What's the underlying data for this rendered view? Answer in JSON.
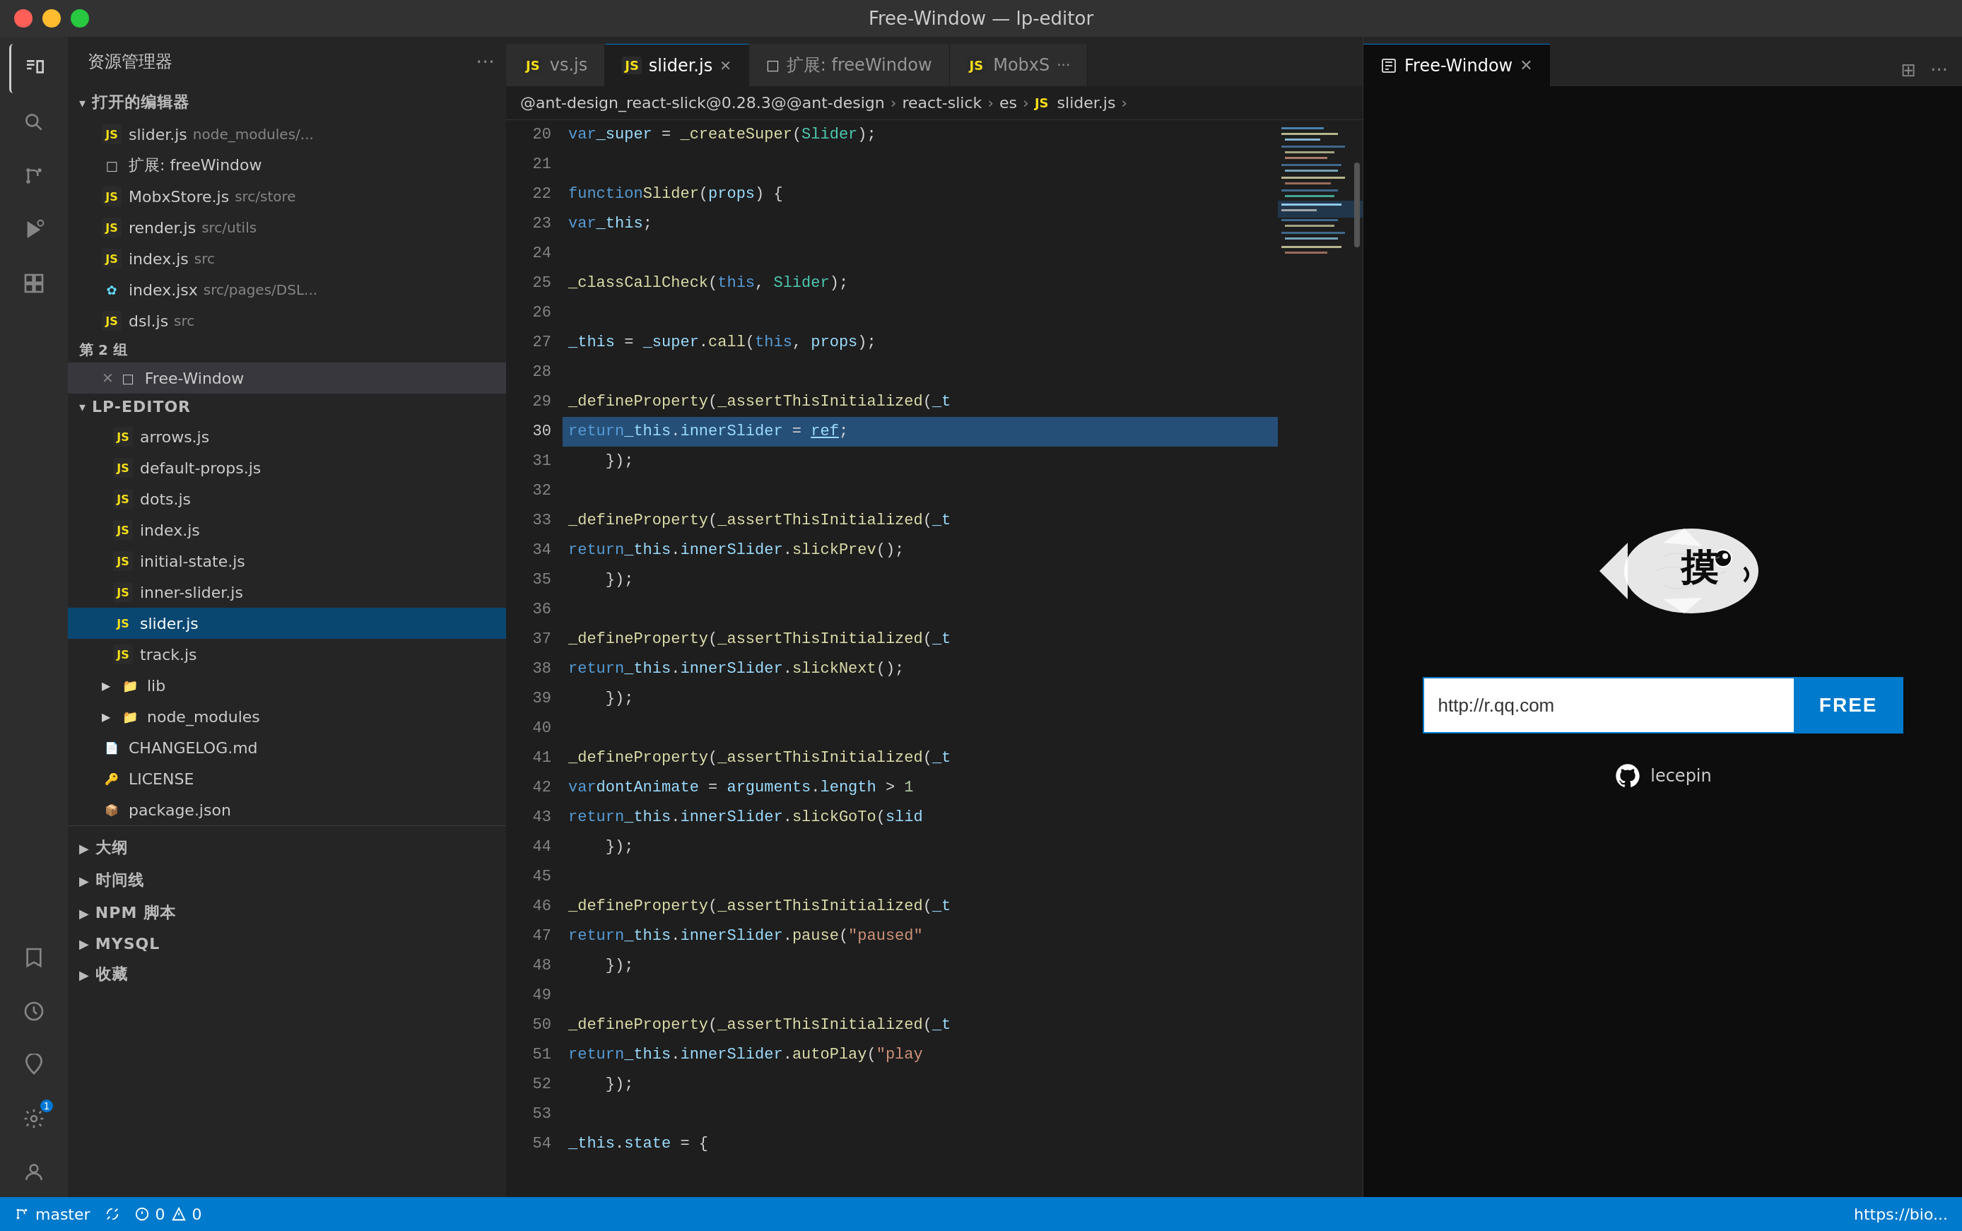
{
  "titlebar": {
    "title": "Free-Window — lp-editor"
  },
  "activitybar": {
    "icons": [
      {
        "name": "explorer-icon",
        "symbol": "⊞",
        "active": true
      },
      {
        "name": "search-icon",
        "symbol": "🔍"
      },
      {
        "name": "source-control-icon",
        "symbol": "⎇"
      },
      {
        "name": "run-icon",
        "symbol": "▷"
      },
      {
        "name": "extensions-icon",
        "symbol": "⊡"
      },
      {
        "name": "bookmarks-icon",
        "symbol": "🔖"
      },
      {
        "name": "timeline-icon",
        "symbol": "◷"
      },
      {
        "name": "favorites-icon",
        "symbol": "♡"
      },
      {
        "name": "security-icon",
        "symbol": "🛡"
      }
    ]
  },
  "sidebar": {
    "tab": "资源管理器",
    "open_editors": {
      "label": "打开的编辑器",
      "files": [
        {
          "name": "slider.js",
          "path": "node_modules/...",
          "type": "js"
        },
        {
          "name": "扩展: freeWindow",
          "type": "ext"
        },
        {
          "name": "MobxStore.js",
          "path": "src/store",
          "type": "js"
        },
        {
          "name": "render.js",
          "path": "src/utils",
          "type": "js"
        },
        {
          "name": "index.js",
          "path": "src",
          "type": "js"
        },
        {
          "name": "index.jsx",
          "path": "src/pages/DSL...",
          "type": "jsx"
        },
        {
          "name": "dsl.js",
          "path": "src",
          "type": "js"
        }
      ]
    },
    "group2": {
      "label": "第 2 组",
      "files": [
        {
          "name": "Free-Window",
          "type": "freewindow",
          "active": true
        }
      ]
    },
    "lp_editor": {
      "label": "LP-EDITOR",
      "files": [
        {
          "name": "arrows.js",
          "type": "js"
        },
        {
          "name": "default-props.js",
          "type": "js"
        },
        {
          "name": "dots.js",
          "type": "js"
        },
        {
          "name": "index.js",
          "type": "js"
        },
        {
          "name": "initial-state.js",
          "type": "js"
        },
        {
          "name": "inner-slider.js",
          "type": "js"
        },
        {
          "name": "slider.js",
          "type": "js",
          "selected": true
        },
        {
          "name": "track.js",
          "type": "js"
        }
      ],
      "folders": [
        {
          "name": "lib"
        },
        {
          "name": "node_modules"
        }
      ],
      "root_files": [
        {
          "name": "CHANGELOG.md"
        },
        {
          "name": "LICENSE"
        },
        {
          "name": "package.json"
        }
      ]
    },
    "bottom_sections": [
      {
        "name": "大纲"
      },
      {
        "name": "时间线"
      },
      {
        "name": "NPM 脚本"
      },
      {
        "name": "MYSQL"
      },
      {
        "name": "收藏"
      }
    ]
  },
  "editor": {
    "tabs": [
      {
        "label": "vs.js",
        "type": "js",
        "active": false
      },
      {
        "label": "slider.js",
        "type": "js",
        "active": true
      },
      {
        "label": "扩展: freeWindow",
        "type": "ext",
        "active": false
      },
      {
        "label": "JS MobxS",
        "type": "js",
        "active": false,
        "more": true
      }
    ],
    "breadcrumb": {
      "parts": [
        "@ant-design_react-slick@0.28.3@@ant-design",
        "react-slick",
        "es",
        "JS slider.js"
      ]
    },
    "lines": [
      {
        "num": 20,
        "code": "  var _super = _createSuper(Slider);"
      },
      {
        "num": 21,
        "code": ""
      },
      {
        "num": 22,
        "code": "  function Slider(props) {"
      },
      {
        "num": 23,
        "code": "    var _this;"
      },
      {
        "num": 24,
        "code": ""
      },
      {
        "num": 25,
        "code": "    _classCallCheck(this, Slider);"
      },
      {
        "num": 26,
        "code": ""
      },
      {
        "num": 27,
        "code": "    _this = _super.call(this, props);"
      },
      {
        "num": 28,
        "code": ""
      },
      {
        "num": 29,
        "code": "    _defineProperty(_assertThisInitialized(_t"
      },
      {
        "num": 30,
        "code": "      return _this.innerSlider = ref;",
        "highlighted": true
      },
      {
        "num": 31,
        "code": "    });"
      },
      {
        "num": 32,
        "code": ""
      },
      {
        "num": 33,
        "code": "    _defineProperty(_assertThisInitialized(_t"
      },
      {
        "num": 34,
        "code": "      return _this.innerSlider.slickPrev();"
      },
      {
        "num": 35,
        "code": "    });"
      },
      {
        "num": 36,
        "code": ""
      },
      {
        "num": 37,
        "code": "    _defineProperty(_assertThisInitialized(_t"
      },
      {
        "num": 38,
        "code": "      return _this.innerSlider.slickNext();"
      },
      {
        "num": 39,
        "code": "    });"
      },
      {
        "num": 40,
        "code": ""
      },
      {
        "num": 41,
        "code": "    _defineProperty(_assertThisInitialized(_t"
      },
      {
        "num": 42,
        "code": "      var dontAnimate = arguments.length > 1"
      },
      {
        "num": 43,
        "code": "      return _this.innerSlider.slickGoTo(slid"
      },
      {
        "num": 44,
        "code": "    });"
      },
      {
        "num": 45,
        "code": ""
      },
      {
        "num": 46,
        "code": "    _defineProperty(_assertThisInitialized(_t"
      },
      {
        "num": 47,
        "code": "      return _this.innerSlider.pause(\"paused\""
      },
      {
        "num": 48,
        "code": "    });"
      },
      {
        "num": 49,
        "code": ""
      },
      {
        "num": 50,
        "code": "    _defineProperty(_assertThisInitialized(_t"
      },
      {
        "num": 51,
        "code": "      return _this.innerSlider.autoPlay(\"play"
      },
      {
        "num": 52,
        "code": "    });"
      },
      {
        "num": 53,
        "code": ""
      },
      {
        "num": 54,
        "code": "    _this.state = {"
      }
    ]
  },
  "free_window": {
    "tab_label": "Free-Window",
    "url_placeholder": "http://r.qq.com",
    "btn_label": "FREE",
    "github_label": "lecepin",
    "fish_text": "摸"
  },
  "statusbar": {
    "branch": "master",
    "errors": "0",
    "warnings": "0",
    "right_text": "https://bio..."
  }
}
